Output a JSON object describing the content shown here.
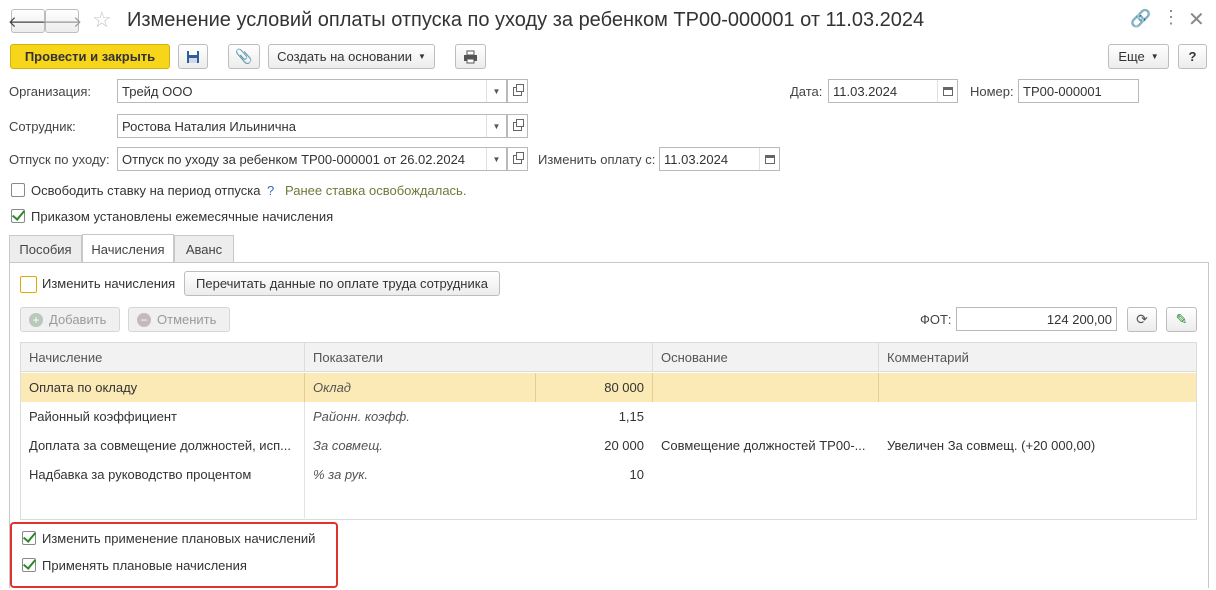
{
  "window": {
    "title": "Изменение условий оплаты отпуска по уходу за ребенком ТР00-000001 от 11.03.2024"
  },
  "toolbar": {
    "post_close_label": "Провести и закрыть",
    "create_based_label": "Создать на основании",
    "more_label": "Еще",
    "help_label": "?"
  },
  "fields": {
    "org_label": "Организация:",
    "org_value": "Трейд ООО",
    "date_label": "Дата:",
    "date_value": "11.03.2024",
    "number_label": "Номер:",
    "number_value": "ТР00-000001",
    "employee_label": "Сотрудник:",
    "employee_value": "Ростова Наталия Ильинична",
    "leave_label": "Отпуск по уходу:",
    "leave_value": "Отпуск по уходу за ребенком ТР00-000001 от 26.02.2024",
    "change_pay_label": "Изменить оплату с:",
    "change_pay_value": "11.03.2024"
  },
  "options": {
    "free_rate_label": "Освободить ставку на период отпуска",
    "free_rate_checked": false,
    "help_mark": "?",
    "free_rate_note": "Ранее ставка освобождалась.",
    "monthly_label": "Приказом установлены ежемесячные начисления",
    "monthly_checked": true
  },
  "tabs": [
    {
      "label": "Пособия",
      "active": false
    },
    {
      "label": "Начисления",
      "active": true
    },
    {
      "label": "Аванс",
      "active": false
    }
  ],
  "accruals": {
    "change_label": "Изменить начисления",
    "change_checked": false,
    "reread_label": "Перечитать данные по оплате труда сотрудника",
    "add_label": "Добавить",
    "cancel_label": "Отменить",
    "fot_label": "ФОТ:",
    "fot_value": "124 200,00",
    "columns": [
      "Начисление",
      "Показатели",
      "Основание",
      "Комментарий"
    ],
    "rows": [
      {
        "accrual": "Оплата по окладу",
        "indicator": "Оклад",
        "value": "80 000",
        "basis": "",
        "comment": "",
        "selected": true
      },
      {
        "accrual": "Районный коэффициент",
        "indicator": "Районн. коэфф.",
        "value": "1,15",
        "basis": "",
        "comment": "",
        "selected": false
      },
      {
        "accrual": "Доплата за совмещение должностей, исп...",
        "indicator": "За совмещ.",
        "value": "20 000",
        "basis": "Совмещение должностей ТР00-...",
        "comment": "Увеличен За совмещ. (+20 000,00)",
        "selected": false
      },
      {
        "accrual": "Надбавка за руководство процентом",
        "indicator": "% за рук.",
        "value": "10",
        "basis": "",
        "comment": "",
        "selected": false
      }
    ],
    "change_planned_label": "Изменить применение плановых начислений",
    "change_planned_checked": true,
    "apply_planned_label": "Применять плановые начисления",
    "apply_planned_checked": true
  },
  "colors": {
    "accent_yellow": "#f7d51a",
    "selected_row": "#fbeab6",
    "highlight_frame": "#e0332b",
    "note_green": "#6e7a3a"
  }
}
